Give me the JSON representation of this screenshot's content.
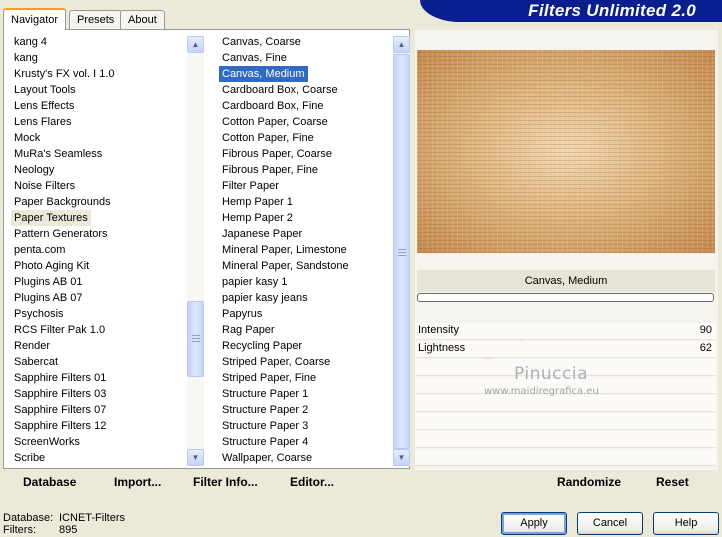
{
  "tabs": [
    {
      "label": "Navigator",
      "active": true
    },
    {
      "label": "Presets",
      "active": false
    },
    {
      "label": "About",
      "active": false
    }
  ],
  "app_title": "Filters Unlimited 2.0",
  "categories": {
    "items": [
      "kang 4",
      "kang",
      "Krusty's FX vol. I 1.0",
      "Layout Tools",
      "Lens Effects",
      "Lens Flares",
      "Mock",
      "MuRa's Seamless",
      "Neology",
      "Noise Filters",
      "Paper Backgrounds",
      "Paper Textures",
      "Pattern Generators",
      "penta.com",
      "Photo Aging Kit",
      "Plugins AB 01",
      "Plugins AB 07",
      "Psychosis",
      "RCS Filter Pak 1.0",
      "Render",
      "Sabercat",
      "Sapphire Filters 01",
      "Sapphire Filters 03",
      "Sapphire Filters 07",
      "Sapphire Filters 12",
      "ScreenWorks",
      "Scribe"
    ],
    "selected": "Paper Textures"
  },
  "filters": {
    "items": [
      "Canvas, Coarse",
      "Canvas, Fine",
      "Canvas, Medium",
      "Cardboard Box, Coarse",
      "Cardboard Box, Fine",
      "Cotton Paper, Coarse",
      "Cotton Paper, Fine",
      "Fibrous Paper, Coarse",
      "Fibrous Paper, Fine",
      "Filter Paper",
      "Hemp Paper 1",
      "Hemp Paper 2",
      "Japanese Paper",
      "Mineral Paper, Limestone",
      "Mineral Paper, Sandstone",
      "papier kasy 1",
      "papier kasy jeans",
      "Papyrus",
      "Rag Paper",
      "Recycling Paper",
      "Striped Paper, Coarse",
      "Striped Paper, Fine",
      "Structure Paper 1",
      "Structure Paper 2",
      "Structure Paper 3",
      "Structure Paper 4",
      "Wallpaper, Coarse"
    ],
    "selected": "Canvas, Medium",
    "marked": [
      "papier kasy 1",
      "papier kasy jeans"
    ]
  },
  "toolbar": {
    "database": "Database",
    "import": "Import...",
    "filter_info": "Filter Info...",
    "editor": "Editor..."
  },
  "preview": {
    "filter_name": "Canvas, Medium"
  },
  "sliders": [
    {
      "label": "Intensity",
      "value": "90",
      "fraction": 0.353
    },
    {
      "label": "Lightness",
      "value": "62",
      "fraction": 0.243
    }
  ],
  "watermark": {
    "line1": "Pinuccia",
    "line2": "www.maidiregrafica.eu"
  },
  "right_toolbar": {
    "randomize": "Randomize",
    "reset": "Reset"
  },
  "status": {
    "database_label": "Database:",
    "database_value": "ICNET-Filters",
    "filters_label": "Filters:",
    "filters_value": "895"
  },
  "dialog_buttons": {
    "apply": "Apply",
    "cancel": "Cancel",
    "help": "Help"
  }
}
